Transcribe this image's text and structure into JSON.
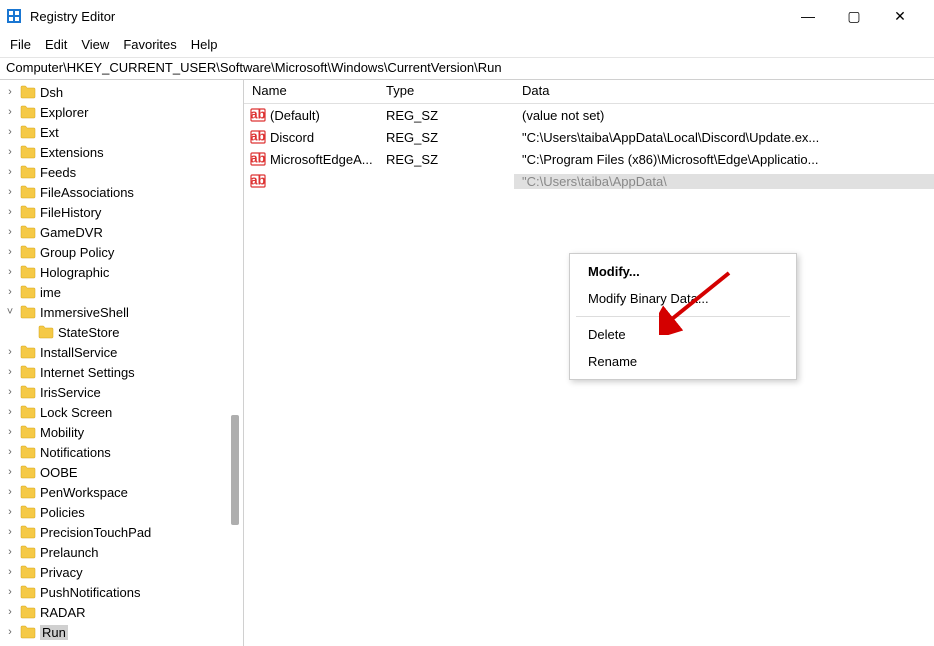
{
  "title": "Registry Editor",
  "menubar": {
    "file": "File",
    "edit": "Edit",
    "view": "View",
    "favorites": "Favorites",
    "help": "Help"
  },
  "address": "Computer\\HKEY_CURRENT_USER\\Software\\Microsoft\\Windows\\CurrentVersion\\Run",
  "tree": {
    "items": [
      {
        "label": "Dsh"
      },
      {
        "label": "Explorer"
      },
      {
        "label": "Ext"
      },
      {
        "label": "Extensions"
      },
      {
        "label": "Feeds"
      },
      {
        "label": "FileAssociations"
      },
      {
        "label": "FileHistory"
      },
      {
        "label": "GameDVR"
      },
      {
        "label": "Group Policy"
      },
      {
        "label": "Holographic"
      },
      {
        "label": "ime"
      },
      {
        "label": "ImmersiveShell",
        "expanded": true,
        "children": [
          {
            "label": "StateStore"
          }
        ]
      },
      {
        "label": "InstallService"
      },
      {
        "label": "Internet Settings"
      },
      {
        "label": "IrisService"
      },
      {
        "label": "Lock Screen"
      },
      {
        "label": "Mobility"
      },
      {
        "label": "Notifications"
      },
      {
        "label": "OOBE"
      },
      {
        "label": "PenWorkspace"
      },
      {
        "label": "Policies"
      },
      {
        "label": "PrecisionTouchPad"
      },
      {
        "label": "Prelaunch"
      },
      {
        "label": "Privacy"
      },
      {
        "label": "PushNotifications"
      },
      {
        "label": "RADAR"
      },
      {
        "label": "Run",
        "selected": true
      }
    ]
  },
  "list": {
    "headers": {
      "name": "Name",
      "type": "Type",
      "data": "Data"
    },
    "rows": [
      {
        "name": "(Default)",
        "type": "REG_SZ",
        "data": "(value not set)"
      },
      {
        "name": "Discord",
        "type": "REG_SZ",
        "data": "\"C:\\Users\\taiba\\AppData\\Local\\Discord\\Update.ex..."
      },
      {
        "name": "MicrosoftEdgeA...",
        "type": "REG_SZ",
        "data": "\"C:\\Program Files (x86)\\Microsoft\\Edge\\Applicatio..."
      },
      {
        "name": "",
        "type": "",
        "data": "\"C:\\Users\\taiba\\AppData\\",
        "selected": true
      }
    ]
  },
  "context_menu": {
    "modify": "Modify...",
    "modify_binary": "Modify Binary Data...",
    "delete": "Delete",
    "rename": "Rename"
  }
}
